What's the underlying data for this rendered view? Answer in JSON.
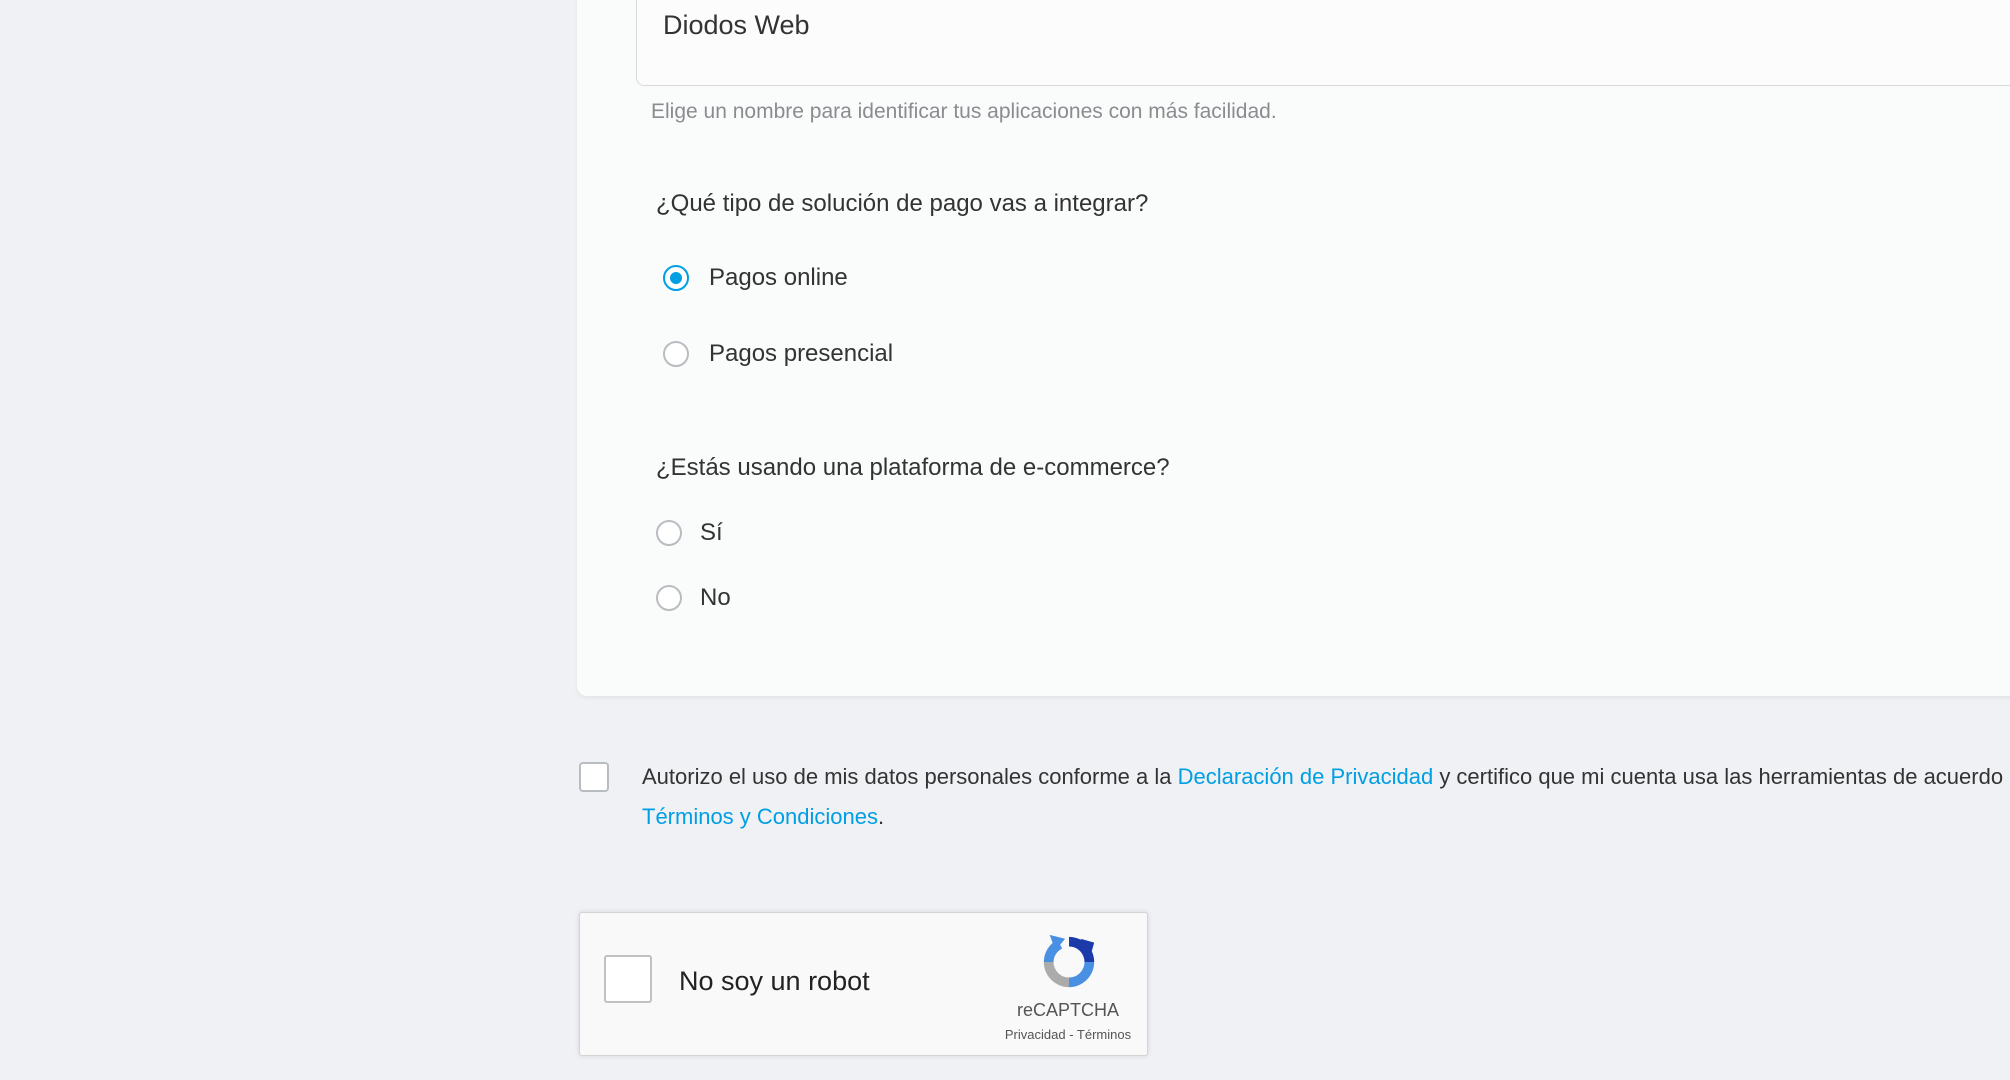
{
  "form": {
    "app_name": {
      "value": "Diodos Web",
      "helper": "Elige un nombre para identificar tus aplicaciones con más facilidad."
    },
    "payment_solution": {
      "question": "¿Qué tipo de solución de pago vas a integrar?",
      "options": [
        {
          "label": "Pagos online",
          "selected": true
        },
        {
          "label": "Pagos presencial",
          "selected": false
        }
      ]
    },
    "ecommerce": {
      "question": "¿Estás usando una plataforma de e-commerce?",
      "options": [
        {
          "label": "Sí",
          "selected": false
        },
        {
          "label": "No",
          "selected": false
        }
      ]
    }
  },
  "consent": {
    "checked": false,
    "text_1": "Autorizo el uso de mis datos personales conforme a la ",
    "privacy_link": "Declaración de Privacidad",
    "text_2": " y certifico que mi cuenta usa las herramientas de",
    "text_3": " acuerdo a los ",
    "terms_link": "Términos y Condiciones",
    "text_4": "."
  },
  "recaptcha": {
    "label": "No soy un robot",
    "brand": "reCAPTCHA",
    "privacy": "Privacidad",
    "separator": " - ",
    "terms": "Términos",
    "checked": false
  },
  "colors": {
    "accent": "#009ee3",
    "text": "#333333",
    "muted": "#8a8c90",
    "background": "#eff1f4",
    "card": "#fafbfb"
  }
}
